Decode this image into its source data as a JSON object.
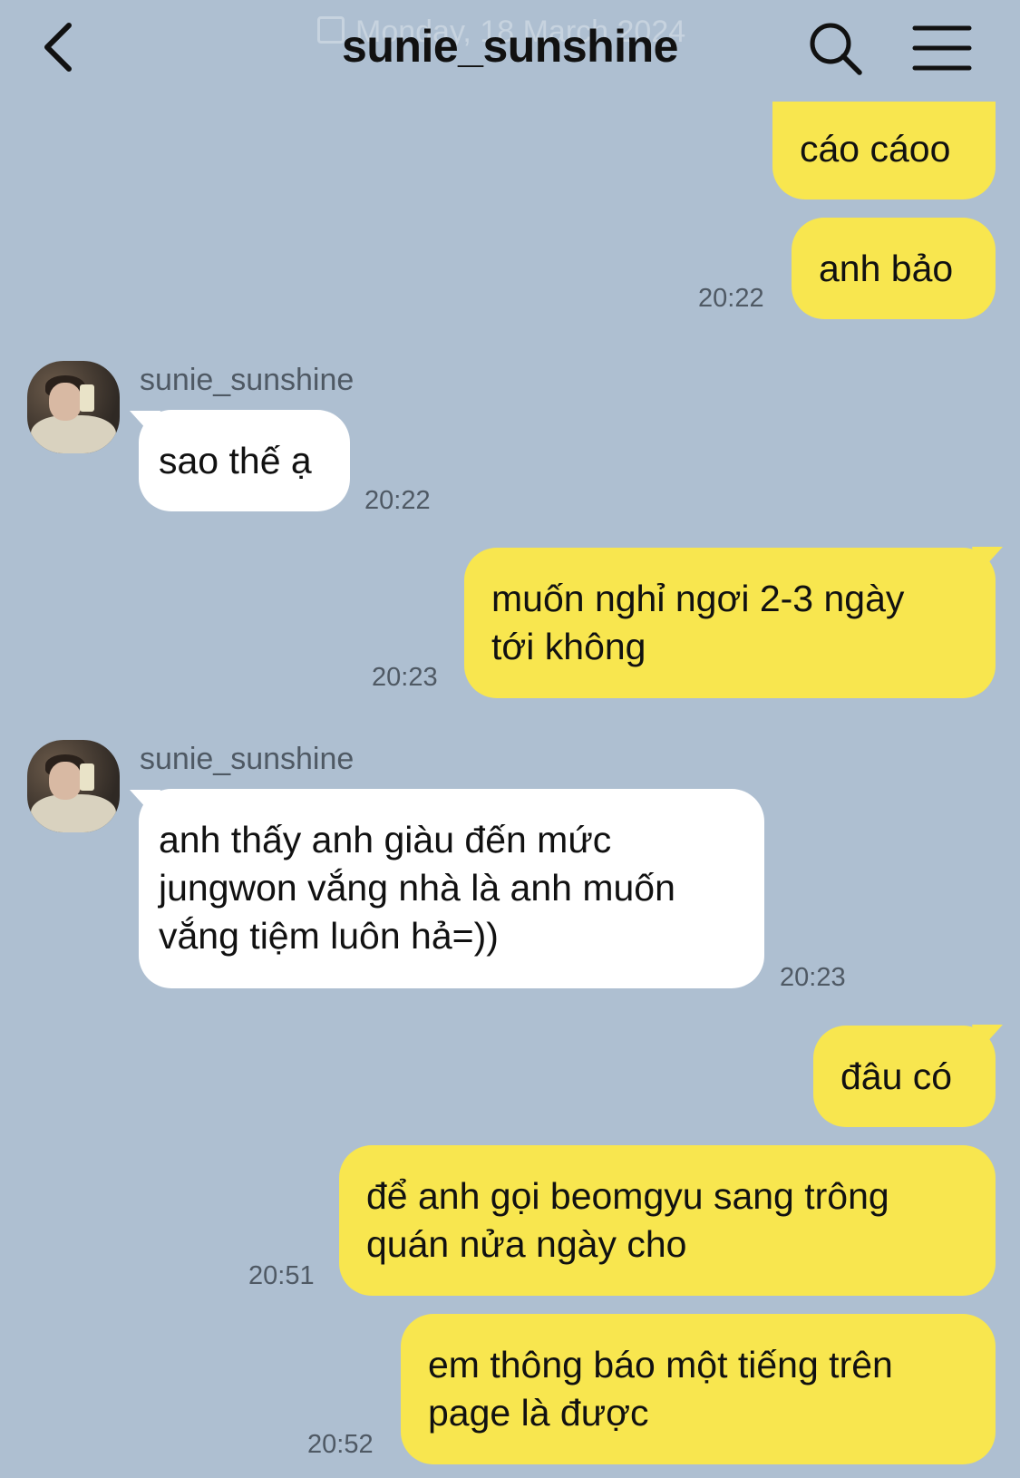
{
  "header": {
    "title": "sunie_sunshine",
    "date_ghost": "Monday, 18 March 2024"
  },
  "icons": {
    "back": "chevron-left-icon",
    "search": "search-icon",
    "menu": "hamburger-menu-icon"
  },
  "colors": {
    "background": "#aebfd1",
    "outgoing_bubble": "#f8e64f",
    "incoming_bubble": "#ffffff",
    "timestamp": "#4f5964"
  },
  "messages": [
    {
      "direction": "out",
      "text": "cáo cáoo",
      "time": ""
    },
    {
      "direction": "out",
      "text": "anh bảo",
      "time": "20:22"
    },
    {
      "direction": "in",
      "sender": "sunie_sunshine",
      "text": "sao thế ạ",
      "time": "20:22"
    },
    {
      "direction": "out",
      "lines": [
        "muốn nghỉ ngơi 2-3 ngày",
        "tới không"
      ],
      "time": "20:23"
    },
    {
      "direction": "in",
      "sender": "sunie_sunshine",
      "lines": [
        "anh thấy anh giàu đến mức",
        "jungwon vắng nhà là anh muốn",
        "vắng tiệm luôn hả=))"
      ],
      "time": "20:23"
    },
    {
      "direction": "out",
      "text": "đâu có",
      "time": ""
    },
    {
      "direction": "out",
      "lines": [
        "để anh gọi beomgyu sang trông",
        "quán nửa ngày cho"
      ],
      "time": "20:51"
    },
    {
      "direction": "out",
      "lines": [
        "em thông báo một tiếng trên",
        "page là được"
      ],
      "time": "20:52"
    }
  ]
}
